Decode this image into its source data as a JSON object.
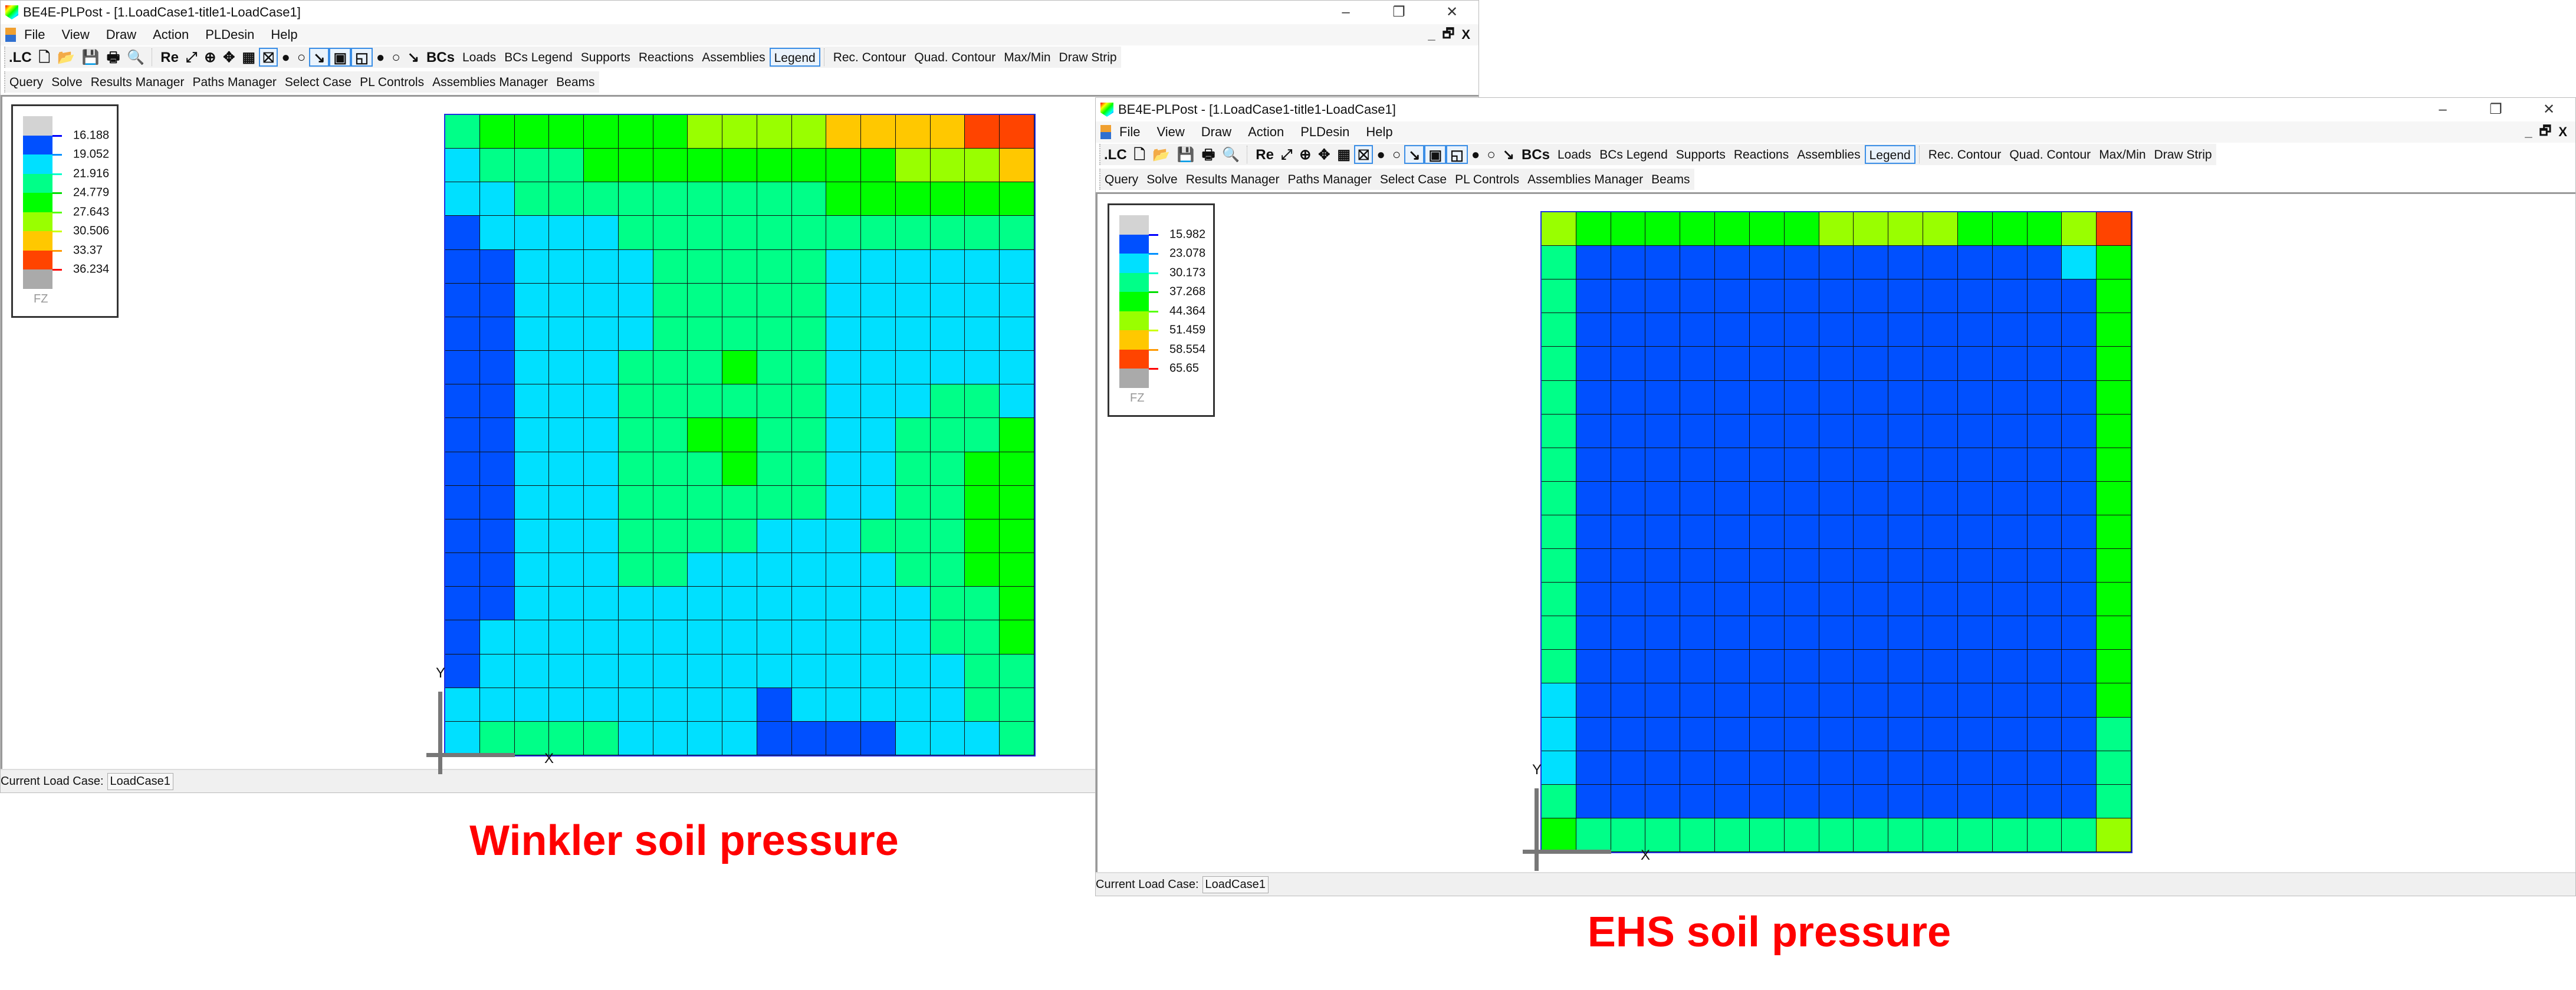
{
  "palette": {
    "B": "#0050ff",
    "C": "#00e0ff",
    "T": "#00ff88",
    "G": "#00ff00",
    "L": "#99ff00",
    "O": "#ffc800",
    "R": "#ff4400"
  },
  "legend_colors": [
    "#d3d3d3",
    "#0050ff",
    "#00e0ff",
    "#00ff88",
    "#00ff00",
    "#99ff00",
    "#ffc800",
    "#ff4400",
    "#aaaaaa"
  ],
  "legend_tick_colors": [
    "#0000ff",
    "#0090ff",
    "#00ffcc",
    "#00dd00",
    "#55ff00",
    "#ccff00",
    "#ff9900",
    "#ff0000"
  ],
  "window": {
    "title": "BE4E-PLPost - [1.LoadCase1-title1-LoadCase1]",
    "controls": {
      "minimize": "–",
      "restore": "❐",
      "close": "✕"
    },
    "mdi_controls": {
      "minimize": "_",
      "restore": "🗗",
      "close": "X"
    },
    "menu": [
      "File",
      "View",
      "Draw",
      "Action",
      "PLDesin",
      "Help"
    ],
    "toolbar1_icons": [
      ".LC",
      "🗋",
      "📂",
      "💾",
      "🖶",
      "🔍",
      "Re",
      "⤢",
      "⊕",
      "✥",
      "▦",
      "⛝",
      "●",
      "○",
      "↘",
      "▣",
      "◱",
      "●",
      "○",
      "↘",
      "BCs"
    ],
    "toolbar1_text": [
      "Loads",
      "BCs Legend",
      "Supports",
      "Reactions",
      "Assemblies",
      "Legend"
    ],
    "toolbar1_text_after": [
      "Rec. Contour",
      "Quad. Contour",
      "Max/Min",
      "Draw Strip"
    ],
    "toolbar2": [
      "Query",
      "Solve",
      "Results Manager",
      "Paths Manager",
      "Select Case",
      "PL Controls",
      "Assemblies Manager",
      "Beams"
    ],
    "status_label": "Current Load Case:",
    "status_value": "LoadCase1"
  },
  "left": {
    "caption": "Winkler soil pressure",
    "legend": {
      "values": [
        "16.188",
        "19.052",
        "21.916",
        "24.779",
        "27.643",
        "30.506",
        "33.37",
        "36.234"
      ],
      "label": "FZ"
    },
    "grid_rows": [
      "TGGGGGGLLLLOOOORR",
      "CTTTGGGGGGGGGLLLO",
      "CCTTTTTTTTTGGGGGG",
      "BCCCCTTTTTTTTTTTT",
      "BBCCCCTTTTTCCCCCC",
      "BBCCCCTTTTTCCCCCC",
      "BBCCCCTTTTTCCCCCC",
      "BBCCCTTTGTTCCCCCC",
      "BBCCCTTTTTTCCCTTC",
      "BBCCCTTGGTTCCTTTG",
      "BBCCCTTTGTTCCTTGG",
      "BBCCCTTTTTTCCTTGG",
      "BBCCCTTTTCCCTTTGG",
      "BBCCCTTCCCCCCTTGG",
      "BBCCCCCCCCCCCCTTG",
      "BCCCCCCCCCCCCCTTG",
      "BCCCCCCCCCCCCCCTT",
      "CCCCCCCCCBCCCCCTT",
      "CTTTTCCCCBBBBCCCT"
    ],
    "axis_x": "X",
    "axis_y": "Y"
  },
  "right": {
    "caption": "EHS soil pressure",
    "legend": {
      "values": [
        "15.982",
        "23.078",
        "30.173",
        "37.268",
        "44.364",
        "51.459",
        "58.554",
        "65.65"
      ],
      "label": "FZ"
    },
    "grid_rows": [
      "LGGGGGGGLLLLGGGLR",
      "TBBBBBBBBBBBBBBCG",
      "TBBBBBBBBBBBBBBBG",
      "TBBBBBBBBBBBBBBBG",
      "TBBBBBBBBBBBBBBBG",
      "TBBBBBBBBBBBBBBBG",
      "TBBBBBBBBBBBBBBBG",
      "TBBBBBBBBBBBBBBBG",
      "TBBBBBBBBBBBBBBBG",
      "TBBBBBBBBBBBBBBBG",
      "TBBBBBBBBBBBBBBBG",
      "TBBBBBBBBBBBBBBBG",
      "TBBBBBBBBBBBBBBBG",
      "TBBBBBBBBBBBBBBBG",
      "CBBBBBBBBBBBBBBBG",
      "CBBBBBBBBBBBBBBBT",
      "CBBBBBBBBBBBBBBBT",
      "TBBBBBBBBBBBBBBBT",
      "GTTTTTTTTTTTTTTTL"
    ],
    "axis_x": "X",
    "axis_y": "Y"
  }
}
